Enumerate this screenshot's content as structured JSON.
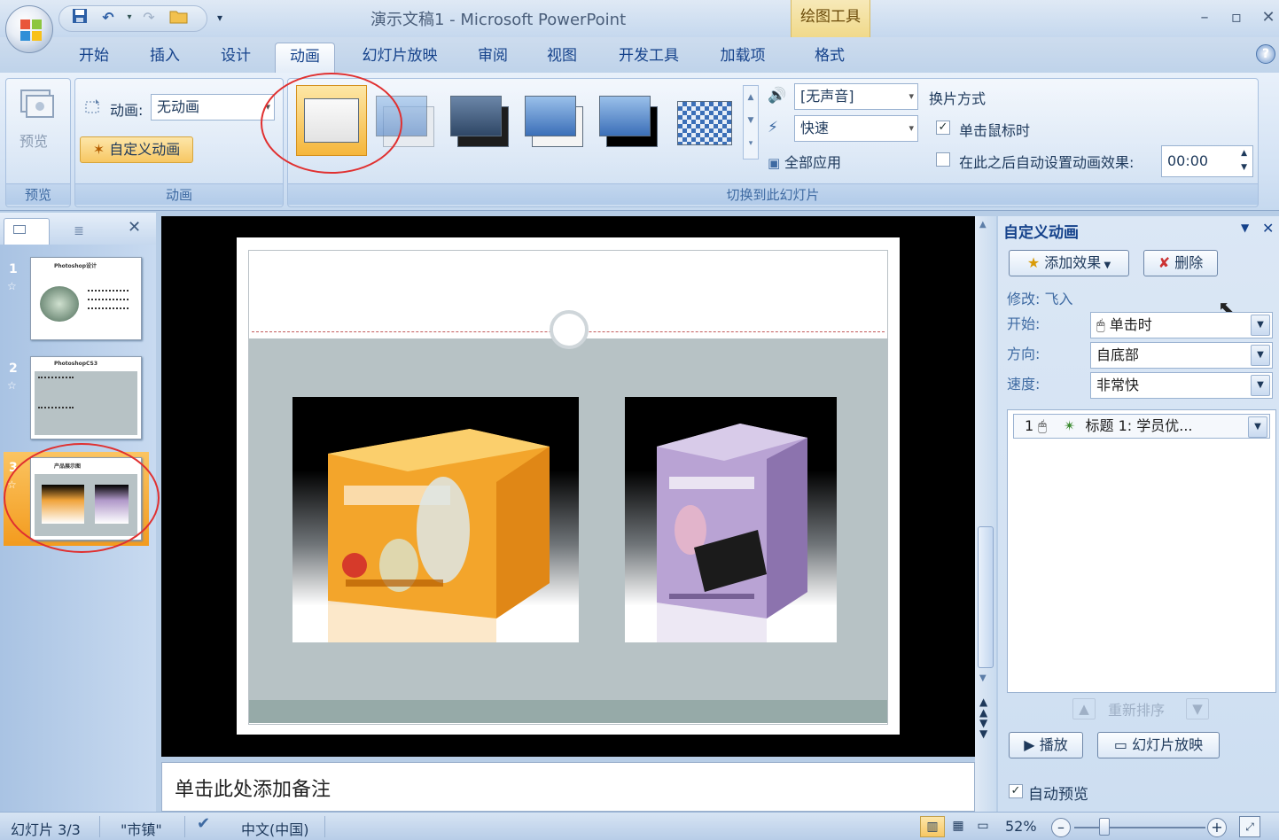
{
  "window": {
    "title": "演示文稿1 - Microsoft PowerPoint",
    "context_tab": "绘图工具"
  },
  "qat": [
    "save-icon",
    "undo-icon",
    "redo-icon",
    "open-icon",
    "customize-icon"
  ],
  "tabs": [
    {
      "label": "开始"
    },
    {
      "label": "插入"
    },
    {
      "label": "设计"
    },
    {
      "label": "动画",
      "active": true
    },
    {
      "label": "幻灯片放映"
    },
    {
      "label": "审阅"
    },
    {
      "label": "视图"
    },
    {
      "label": "开发工具"
    },
    {
      "label": "加载项"
    },
    {
      "label": "格式"
    }
  ],
  "ribbon": {
    "preview": {
      "button": "预览",
      "group": "预览"
    },
    "animations": {
      "anim_label": "动画:",
      "anim_value": "无动画",
      "custom_btn": "自定义动画",
      "group": "动画"
    },
    "transition": {
      "sound_value": "[无声音]",
      "speed_value": "快速",
      "apply_all": "全部应用",
      "mode_title": "换片方式",
      "on_click": "单击鼠标时",
      "on_click_checked": true,
      "auto_after": "在此之后自动设置动画效果:",
      "auto_after_checked": false,
      "auto_time": "00:00",
      "group": "切换到此幻灯片"
    }
  },
  "slides_pane": {
    "slides": [
      {
        "num": "1",
        "title": "Photoshop设计"
      },
      {
        "num": "2",
        "title": "PhotoshopCS3"
      },
      {
        "num": "3",
        "title": "产品展示图"
      }
    ]
  },
  "notes_placeholder": "单击此处添加备注",
  "taskpane": {
    "title": "自定义动画",
    "add_effect": "添加效果",
    "delete": "删除",
    "modify": "修改: 飞入",
    "start_label": "开始:",
    "start_value": "单击时",
    "direction_label": "方向:",
    "direction_value": "自底部",
    "speed_label": "速度:",
    "speed_value": "非常快",
    "list_item": {
      "index": "1",
      "text": "标题 1: 学员优..."
    },
    "reorder": "重新排序",
    "play": "播放",
    "slideshow": "幻灯片放映",
    "auto_preview": "自动预览",
    "auto_preview_checked": true
  },
  "statusbar": {
    "slide_info": "幻灯片 3/3",
    "theme": "\"市镇\"",
    "language": "中文(中国)",
    "zoom": "52%"
  },
  "colors": {
    "accent_orange": "#f6b73e",
    "ribbon_blue": "#d3e2f4",
    "annotation_red": "#e03030"
  }
}
